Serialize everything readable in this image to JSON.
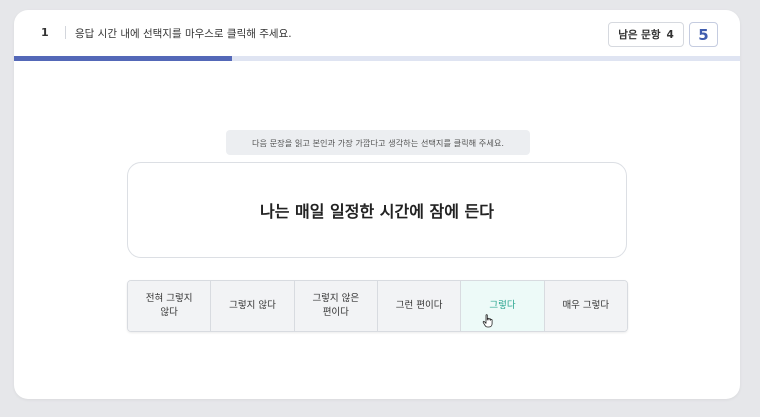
{
  "header": {
    "question_number": "1",
    "instruction": "응답 시간 내에 선택지를 마우스로 클릭해 주세요.",
    "remaining_label": "남은 문항",
    "remaining_count": "4",
    "counter": "5"
  },
  "progress": {
    "fraction": 0.3,
    "fill_color": "#5468b8",
    "track_color": "#dfe4f2"
  },
  "guide_text": "다음 문장을 읽고 본인과 가장 가깝다고 생각하는 선택지를 클릭해 주세요.",
  "statement": "나는 매일 일정한 시간에 잠에 든다",
  "choices": [
    {
      "label": "전혀 그렇지 않다"
    },
    {
      "label": "그렇지 않다"
    },
    {
      "label": "그렇지 않은 편이다"
    },
    {
      "label": "그런 편이다"
    },
    {
      "label": "그렇다",
      "state": "hover"
    },
    {
      "label": "매우 그렇다"
    }
  ],
  "colors": {
    "accent": "#3f5cae",
    "hover_text": "#2aa58f",
    "hover_bg": "#edfaf8"
  },
  "icons": {
    "cursor": "hand-pointer-icon"
  }
}
